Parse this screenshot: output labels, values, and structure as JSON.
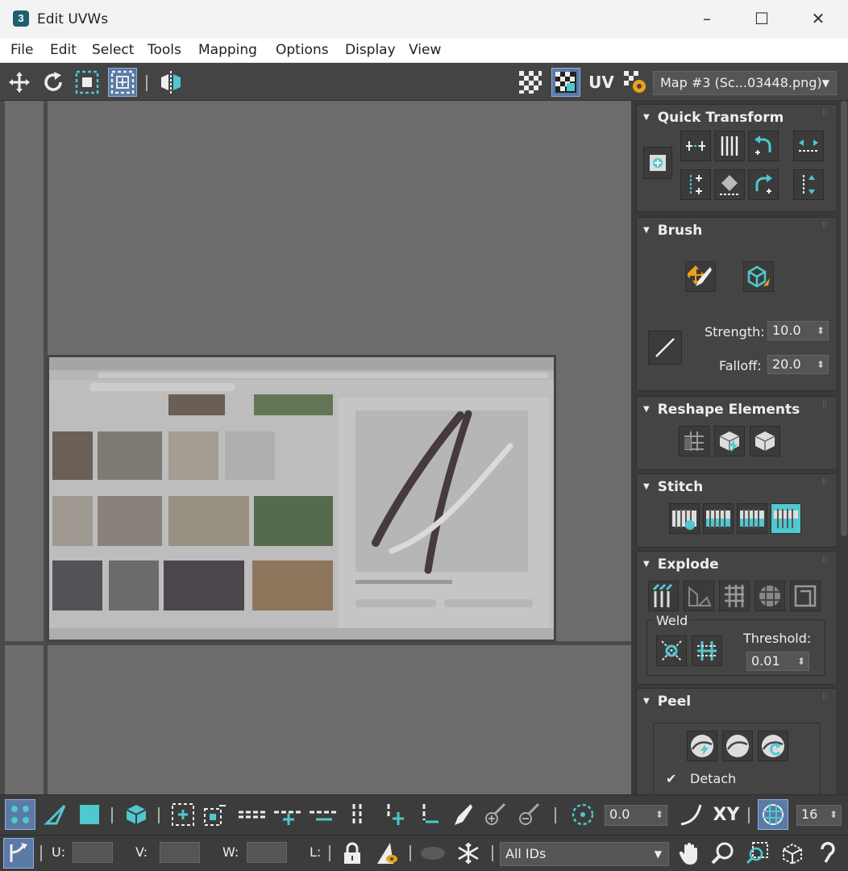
{
  "window": {
    "title": "Edit UVWs",
    "app_icon_label": "3",
    "minimize": "–",
    "maximize": "☐",
    "close": "✕"
  },
  "menu": [
    "File",
    "Edit",
    "Select",
    "Tools",
    "Mapping",
    "Options",
    "Display",
    "View"
  ],
  "toolbar": {
    "uv_label": "UV",
    "map_select_value": "Map #3 (Sc...03448.png)"
  },
  "panel": {
    "quick_transform": {
      "title": "Quick Transform"
    },
    "brush": {
      "title": "Brush",
      "strength_label": "Strength:",
      "strength_value": "10.0",
      "falloff_label": "Falloff:",
      "falloff_value": "20.0"
    },
    "reshape": {
      "title": "Reshape Elements"
    },
    "stitch": {
      "title": "Stitch"
    },
    "explode": {
      "title": "Explode",
      "weld_label": "Weld",
      "threshold_label": "Threshold:",
      "threshold_value": "0.01"
    },
    "peel": {
      "title": "Peel",
      "detach_label": "Detach"
    }
  },
  "bottom": {
    "rotate_value": "0.0",
    "xy_label": "XY",
    "grid_value": "16",
    "u_label": "U:",
    "v_label": "V:",
    "w_label": "W:",
    "l_label": "L:",
    "ids_value": "All IDs"
  },
  "texture": {
    "result_caption": "Vanilla Bean Pods",
    "colors": {
      "accent": "#4fc8cf",
      "bg": "#444444",
      "viewport": "#6c6c6c"
    }
  }
}
